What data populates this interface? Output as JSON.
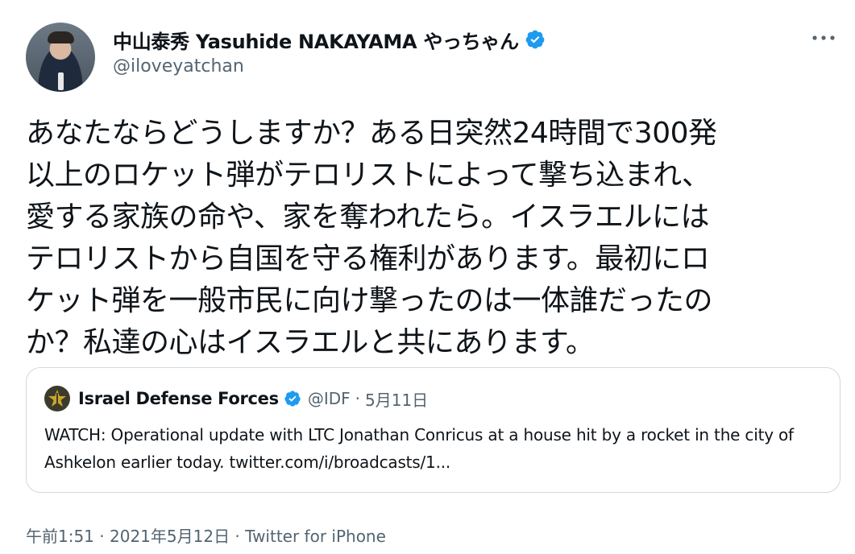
{
  "author": {
    "display_name": "中山泰秀 Yasuhide NAKAYAMA やっちゃん",
    "handle": "@iloveyatchan",
    "verified": true
  },
  "tweet": {
    "text": "あなたならどうしますか？ある日突然24時間で300発\n以上のロケット弾がテロリストによって撃ち込まれ、\n愛する家族の命や、家を奪われたら。イスラエルには\nテロリストから自国を守る権利があります。最初にロ\nケット弾を一般市民に向け撃ったのは一体誰だったの\nか？私達の心はイスラエルと共にあります。"
  },
  "quoted_tweet": {
    "display_name": "Israel Defense Forces",
    "handle": "@IDF",
    "separator": "·",
    "date": "5月11日",
    "text": "WATCH: Operational update with LTC Jonathan Conricus at a house hit by a rocket in the city of Ashkelon earlier today. twitter.com/i/broadcasts/1..."
  },
  "footer": {
    "time": "午前1:51",
    "sep1": " · ",
    "date": "2021年5月12日",
    "sep2": " · ",
    "source": "Twitter for iPhone"
  },
  "colors": {
    "verified_blue": "#1d9bf0",
    "secondary_text": "#536471",
    "border": "#cfd9de"
  },
  "icons": {
    "verified": "verified-badge-icon",
    "more": "more-horizontal-icon",
    "idf_logo": "idf-emblem-icon"
  }
}
